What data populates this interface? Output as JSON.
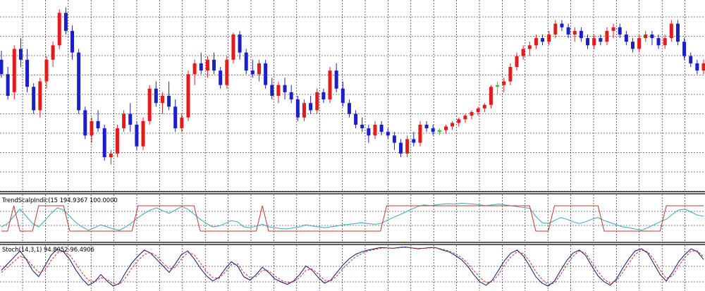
{
  "colors": {
    "background": "#ffffff",
    "grid": "#000000",
    "separator": "#000000",
    "bull_candle": "#e31b1b",
    "bear_candle": "#1a1fc8",
    "doji_up": "#2ecc2e",
    "doji_down": "#2ecc2e",
    "trend_line": "#c0392b",
    "trend_signal": "#3aa7b0",
    "stoch_main": "#0b1470",
    "stoch_signal": "#d12a2a"
  },
  "panes": {
    "trend": {
      "name": "TrendScalpIndic",
      "params": "(15",
      "value1": "194.9367",
      "value2": "100.0000"
    },
    "stoch": {
      "name": "Stoch",
      "params": "(14,3,1)",
      "value1": "94.8052",
      "value2": "96.4906"
    }
  },
  "chart_data": [
    {
      "type": "candlestick",
      "pane": "price",
      "ylim": [
        0,
        100
      ],
      "grid": true,
      "candles": [
        [
          70,
          75,
          60,
          62
        ],
        [
          62,
          66,
          48,
          50
        ],
        [
          52,
          78,
          48,
          76
        ],
        [
          76,
          82,
          66,
          70
        ],
        [
          70,
          76,
          52,
          55
        ],
        [
          55,
          57,
          40,
          42
        ],
        [
          42,
          60,
          38,
          58
        ],
        [
          58,
          72,
          54,
          70
        ],
        [
          70,
          80,
          66,
          78
        ],
        [
          78,
          98,
          76,
          96
        ],
        [
          96,
          99,
          84,
          86
        ],
        [
          86,
          89,
          70,
          74
        ],
        [
          74,
          76,
          40,
          42
        ],
        [
          42,
          44,
          26,
          28
        ],
        [
          28,
          38,
          24,
          36
        ],
        [
          36,
          42,
          30,
          32
        ],
        [
          32,
          34,
          14,
          16
        ],
        [
          16,
          20,
          12,
          18
        ],
        [
          18,
          34,
          16,
          32
        ],
        [
          32,
          42,
          30,
          40
        ],
        [
          40,
          46,
          30,
          34
        ],
        [
          34,
          36,
          20,
          22
        ],
        [
          22,
          38,
          20,
          36
        ],
        [
          36,
          56,
          34,
          54
        ],
        [
          54,
          58,
          44,
          46
        ],
        [
          46,
          52,
          40,
          50
        ],
        [
          50,
          58,
          42,
          44
        ],
        [
          44,
          48,
          30,
          32
        ],
        [
          32,
          40,
          30,
          38
        ],
        [
          38,
          64,
          36,
          62
        ],
        [
          62,
          70,
          56,
          68
        ],
        [
          68,
          74,
          62,
          64
        ],
        [
          64,
          72,
          60,
          70
        ],
        [
          70,
          74,
          62,
          64
        ],
        [
          64,
          66,
          54,
          56
        ],
        [
          56,
          72,
          54,
          70
        ],
        [
          70,
          85,
          68,
          84
        ],
        [
          84,
          86,
          70,
          74
        ],
        [
          74,
          76,
          62,
          64
        ],
        [
          64,
          70,
          60,
          62
        ],
        [
          62,
          70,
          58,
          68
        ],
        [
          68,
          70,
          54,
          56
        ],
        [
          56,
          60,
          48,
          50
        ],
        [
          50,
          58,
          46,
          56
        ],
        [
          56,
          60,
          48,
          52
        ],
        [
          52,
          56,
          46,
          48
        ],
        [
          48,
          50,
          36,
          38
        ],
        [
          38,
          48,
          36,
          46
        ],
        [
          46,
          50,
          40,
          42
        ],
        [
          42,
          54,
          40,
          52
        ],
        [
          52,
          54,
          46,
          48
        ],
        [
          48,
          66,
          46,
          64
        ],
        [
          64,
          68,
          52,
          54
        ],
        [
          54,
          58,
          44,
          46
        ],
        [
          46,
          48,
          38,
          40
        ],
        [
          40,
          42,
          32,
          34
        ],
        [
          34,
          38,
          30,
          32
        ],
        [
          32,
          34,
          24,
          28
        ],
        [
          28,
          36,
          26,
          34
        ],
        [
          34,
          36,
          28,
          30
        ],
        [
          30,
          32,
          26,
          28
        ],
        [
          28,
          30,
          20,
          24
        ],
        [
          24,
          26,
          16,
          18
        ],
        [
          18,
          28,
          16,
          26
        ],
        [
          26,
          30,
          22,
          24
        ],
        [
          24,
          36,
          22,
          34
        ],
        [
          34,
          36,
          30,
          32
        ],
        [
          32,
          34,
          28,
          30
        ],
        [
          30,
          32,
          28,
          31
        ],
        [
          31,
          34,
          29,
          33
        ],
        [
          33,
          36,
          31,
          35
        ],
        [
          35,
          38,
          33,
          37
        ],
        [
          37,
          40,
          35,
          39
        ],
        [
          39,
          42,
          37,
          41
        ],
        [
          41,
          44,
          39,
          43
        ],
        [
          43,
          46,
          41,
          45
        ],
        [
          45,
          56,
          43,
          55
        ],
        [
          55,
          58,
          51,
          56
        ],
        [
          56,
          60,
          52,
          58
        ],
        [
          58,
          68,
          56,
          66
        ],
        [
          66,
          74,
          64,
          72
        ],
        [
          72,
          78,
          70,
          76
        ],
        [
          76,
          80,
          72,
          78
        ],
        [
          78,
          84,
          76,
          82
        ],
        [
          82,
          84,
          78,
          80
        ],
        [
          80,
          86,
          78,
          84
        ],
        [
          84,
          92,
          82,
          90
        ],
        [
          90,
          92,
          86,
          88
        ],
        [
          88,
          90,
          82,
          84
        ],
        [
          84,
          88,
          80,
          86
        ],
        [
          86,
          88,
          80,
          82
        ],
        [
          82,
          84,
          76,
          78
        ],
        [
          78,
          84,
          76,
          82
        ],
        [
          82,
          84,
          78,
          80
        ],
        [
          80,
          88,
          78,
          86
        ],
        [
          86,
          90,
          82,
          88
        ],
        [
          88,
          90,
          82,
          84
        ],
        [
          84,
          86,
          78,
          80
        ],
        [
          80,
          82,
          74,
          76
        ],
        [
          76,
          84,
          74,
          82
        ],
        [
          82,
          86,
          80,
          84
        ],
        [
          84,
          86,
          78,
          82
        ],
        [
          82,
          84,
          76,
          78
        ],
        [
          78,
          84,
          76,
          82
        ],
        [
          82,
          92,
          80,
          90
        ],
        [
          90,
          92,
          78,
          80
        ],
        [
          80,
          82,
          70,
          72
        ],
        [
          72,
          74,
          66,
          68
        ],
        [
          68,
          70,
          62,
          64
        ],
        [
          64,
          70,
          62,
          68
        ]
      ]
    },
    {
      "type": "line",
      "pane": "TrendScalpIndic",
      "ylim": [
        0,
        100
      ],
      "series": [
        {
          "values": [
            30,
            38,
            55,
            72,
            55,
            38,
            30,
            45,
            62,
            75,
            70,
            55,
            40,
            30,
            22,
            28,
            35,
            30,
            25,
            22,
            30,
            40,
            52,
            62,
            70,
            75,
            68,
            62,
            70,
            78,
            72,
            60,
            48,
            38,
            30,
            32,
            38,
            45,
            42,
            30,
            28,
            32,
            36,
            30,
            28,
            26,
            25,
            28,
            30,
            35,
            32,
            30,
            28,
            30,
            32,
            35,
            36,
            38,
            40,
            38,
            36,
            38,
            45,
            52,
            58,
            65,
            72,
            78,
            82,
            80,
            82,
            84,
            85,
            84,
            86,
            85,
            84,
            82,
            80,
            82,
            84,
            82,
            80,
            78,
            76,
            74,
            55,
            40,
            38,
            45,
            52,
            48,
            42,
            38,
            42,
            48,
            52,
            45,
            40,
            35,
            30,
            28,
            25,
            22,
            28,
            35,
            42,
            48,
            60,
            70,
            72,
            65,
            58,
            55
          ]
        },
        {
          "values": [
            20,
            20,
            80,
            20,
            20,
            20,
            80,
            80,
            80,
            80,
            80,
            20,
            20,
            20,
            20,
            20,
            20,
            20,
            20,
            20,
            20,
            20,
            80,
            80,
            80,
            80,
            80,
            80,
            80,
            80,
            80,
            80,
            20,
            20,
            20,
            20,
            20,
            20,
            20,
            20,
            20,
            20,
            80,
            20,
            20,
            20,
            20,
            20,
            20,
            20,
            20,
            20,
            20,
            20,
            20,
            20,
            20,
            20,
            20,
            20,
            20,
            20,
            80,
            80,
            80,
            80,
            80,
            80,
            80,
            80,
            80,
            80,
            80,
            80,
            80,
            80,
            80,
            80,
            80,
            80,
            80,
            80,
            80,
            80,
            80,
            80,
            20,
            20,
            20,
            80,
            80,
            80,
            80,
            80,
            80,
            80,
            80,
            20,
            20,
            20,
            20,
            20,
            20,
            20,
            20,
            20,
            20,
            80,
            80,
            80,
            80,
            80,
            80,
            80
          ]
        }
      ]
    },
    {
      "type": "line",
      "pane": "Stoch",
      "ylim": [
        0,
        100
      ],
      "series": [
        {
          "values": [
            45,
            60,
            75,
            90,
            70,
            45,
            30,
            55,
            80,
            95,
            88,
            70,
            45,
            25,
            10,
            18,
            35,
            20,
            8,
            15,
            40,
            62,
            78,
            92,
            85,
            70,
            55,
            40,
            60,
            82,
            90,
            72,
            50,
            32,
            20,
            28,
            48,
            65,
            55,
            30,
            22,
            35,
            52,
            40,
            25,
            18,
            12,
            20,
            35,
            55,
            45,
            28,
            15,
            22,
            40,
            58,
            72,
            82,
            88,
            92,
            95,
            98,
            97,
            96,
            98,
            99,
            97,
            95,
            96,
            98,
            97,
            92,
            88,
            80,
            70,
            55,
            35,
            18,
            10,
            22,
            45,
            68,
            85,
            92,
            78,
            55,
            30,
            15,
            8,
            20,
            45,
            68,
            85,
            92,
            80,
            55,
            32,
            18,
            10,
            25,
            50,
            72,
            90,
            95,
            85,
            60,
            35,
            20,
            40,
            65,
            82,
            95,
            88,
            70
          ]
        },
        {
          "values": [
            40,
            52,
            65,
            78,
            72,
            55,
            40,
            45,
            68,
            85,
            90,
            80,
            60,
            38,
            22,
            18,
            28,
            24,
            14,
            12,
            28,
            50,
            68,
            82,
            86,
            78,
            62,
            48,
            52,
            72,
            86,
            82,
            62,
            42,
            28,
            26,
            40,
            58,
            60,
            40,
            28,
            30,
            45,
            44,
            32,
            22,
            16,
            18,
            28,
            45,
            48,
            36,
            22,
            20,
            32,
            50,
            64,
            76,
            84,
            90,
            93,
            96,
            97,
            96,
            97,
            98,
            97,
            96,
            96,
            97,
            97,
            94,
            90,
            84,
            75,
            62,
            45,
            28,
            16,
            18,
            35,
            58,
            76,
            88,
            84,
            66,
            42,
            24,
            12,
            15,
            35,
            58,
            78,
            90,
            85,
            64,
            42,
            24,
            14,
            20,
            40,
            62,
            82,
            92,
            88,
            70,
            46,
            26,
            32,
            55,
            75,
            90,
            90,
            76
          ]
        }
      ]
    }
  ]
}
